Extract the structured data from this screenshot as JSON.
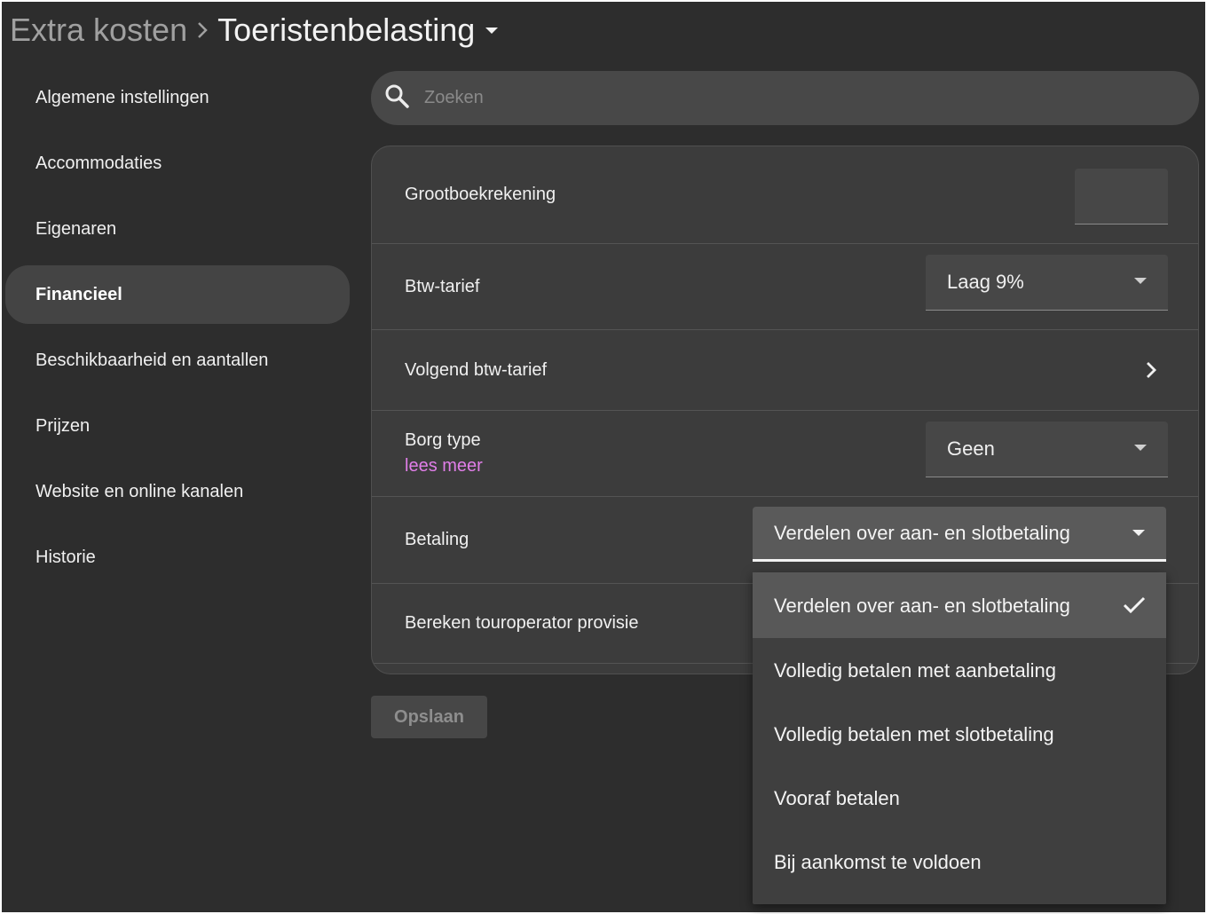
{
  "header": {
    "parent": "Extra kosten",
    "current": "Toeristenbelasting"
  },
  "sidebar": {
    "items": [
      {
        "label": "Algemene instellingen"
      },
      {
        "label": "Accommodaties"
      },
      {
        "label": "Eigenaren"
      },
      {
        "label": "Financieel",
        "active": true
      },
      {
        "label": "Beschikbaarheid en aantallen"
      },
      {
        "label": "Prijzen"
      },
      {
        "label": "Website en online kanalen"
      },
      {
        "label": "Historie"
      }
    ]
  },
  "search": {
    "placeholder": "Zoeken",
    "value": ""
  },
  "form": {
    "grootboek": {
      "label": "Grootboekrekening",
      "value": ""
    },
    "btw": {
      "label": "Btw-tarief",
      "value": "Laag 9%"
    },
    "volgend_btw": {
      "label": "Volgend btw-tarief"
    },
    "borg": {
      "label": "Borg type",
      "link": "lees meer",
      "value": "Geen"
    },
    "betaling": {
      "label": "Betaling",
      "value": "Verdelen over aan- en slotbetaling"
    },
    "provisie": {
      "label": "Bereken touroperator provisie"
    }
  },
  "save_label": "Opslaan",
  "betaling_menu": {
    "options": [
      {
        "label": "Verdelen over aan- en slotbetaling",
        "selected": true
      },
      {
        "label": "Volledig betalen met aanbetaling"
      },
      {
        "label": "Volledig betalen met slotbetaling"
      },
      {
        "label": "Vooraf betalen"
      },
      {
        "label": "Bij aankomst te voldoen"
      }
    ]
  },
  "colors": {
    "background": "#2d2d2d",
    "card": "#3c3c3c",
    "link": "#e07ee8",
    "active_nav": "#444444"
  }
}
